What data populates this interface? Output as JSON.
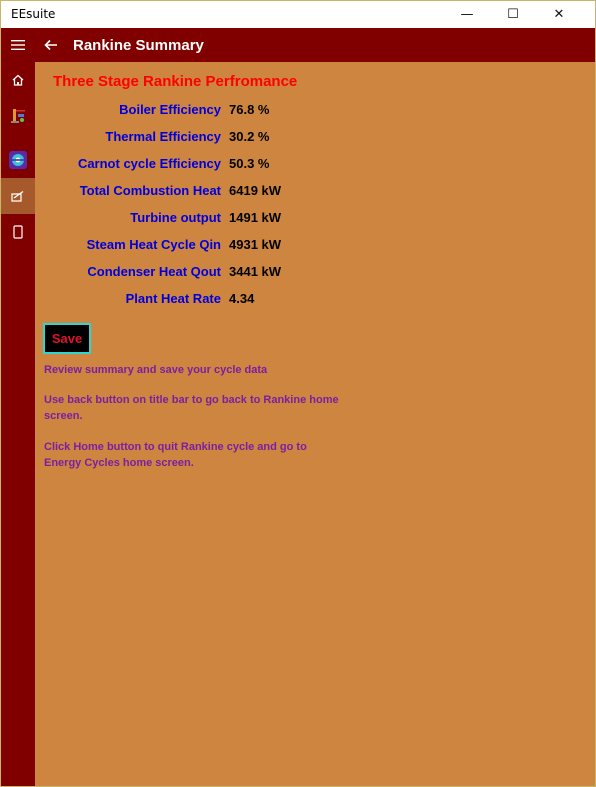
{
  "window": {
    "app_title": "EEsuite",
    "minimize_glyph": "—",
    "maximize_glyph": "☐",
    "close_glyph": "✕"
  },
  "header": {
    "menu_icon": "hamburger-icon",
    "back_icon": "back-arrow-icon",
    "title": "Rankine Summary"
  },
  "sidebar": {
    "items": [
      {
        "icon": "home-icon",
        "selected": false
      },
      {
        "icon": "rankine-cycle-icon",
        "selected": false
      },
      {
        "icon": "heat-pump-icon",
        "selected": false
      },
      {
        "icon": "summary-icon",
        "selected": true
      },
      {
        "icon": "device-icon",
        "selected": false
      }
    ]
  },
  "main": {
    "title": "Three Stage Rankine Perfromance",
    "metrics": [
      {
        "label": "Boiler Efficiency",
        "value": "76.8 %"
      },
      {
        "label": "Thermal Efficiency",
        "value": "30.2 %"
      },
      {
        "label": "Carnot cycle Efficiency",
        "value": "50.3 %"
      },
      {
        "label": "Total Combustion Heat",
        "value": "6419 kW"
      },
      {
        "label": "Turbine output",
        "value": "1491 kW"
      },
      {
        "label": "Steam Heat Cycle Qin",
        "value": "4931 kW"
      },
      {
        "label": "Condenser Heat Qout",
        "value": "3441 kW"
      },
      {
        "label": "Plant Heat Rate",
        "value": "4.34"
      }
    ],
    "save_label": "Save",
    "notes": [
      "Review summary and save your cycle data",
      "Use back button on title bar to go back to Rankine home screen.",
      "Click Home button to quit Rankine cycle and go to Energy Cycles home screen."
    ]
  },
  "colors": {
    "header_bg": "#800000",
    "content_bg": "#cd853f",
    "title_text": "#ff0000",
    "label_text": "#0000dd",
    "note_text": "#7b1fa2",
    "save_border": "#2fd4d4",
    "save_text": "#e01030"
  }
}
